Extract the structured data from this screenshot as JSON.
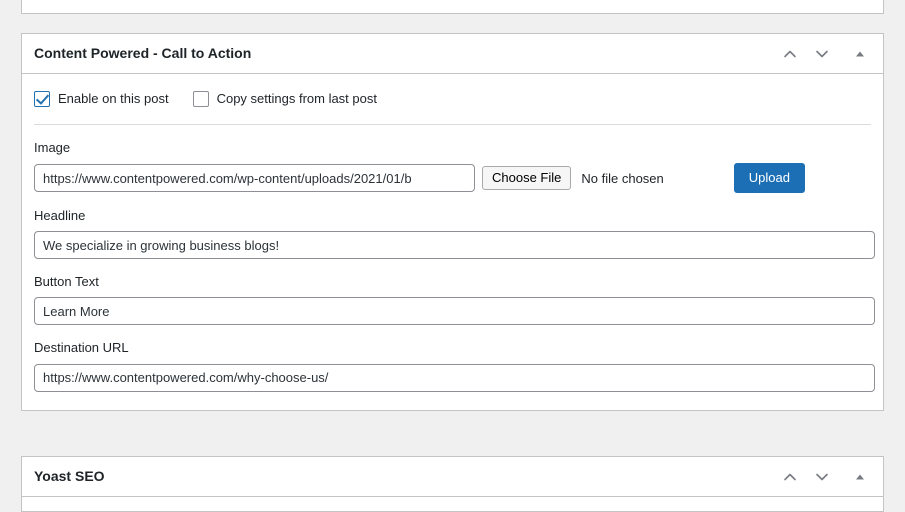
{
  "theme": {
    "background": "#f0f0f1",
    "panel_background": "#ffffff",
    "panel_border": "#c3c4c7",
    "accent_blue": "#2271b1",
    "upload_button_blue": "#1c6fb5",
    "text_color": "#1d2327"
  },
  "panels": [
    {
      "id": "cta",
      "title": "Content Powered - Call to Action",
      "actions": {
        "move_up": "order-higher-icon",
        "move_down": "order-lower-icon",
        "toggle": "toggle-indicator-icon"
      },
      "checkboxes": [
        {
          "label": "Enable on this post",
          "checked": true
        },
        {
          "label": "Copy settings from last post",
          "checked": false
        }
      ],
      "fields": [
        {
          "name": "image",
          "label": "Image",
          "value": "https://www.contentpowered.com/wp-content/uploads/2021/01/b",
          "placeholder": "",
          "file_button": "Choose File",
          "file_status": "No file chosen",
          "upload_button": "Upload"
        },
        {
          "name": "headline",
          "label": "Headline",
          "value": "We specialize in growing business blogs!",
          "placeholder": ""
        },
        {
          "name": "button_text",
          "label": "Button Text",
          "value": "Learn More",
          "placeholder": ""
        },
        {
          "name": "destination_url",
          "label": "Destination URL",
          "value": "https://www.contentpowered.com/why-choose-us/",
          "placeholder": ""
        }
      ]
    },
    {
      "id": "yoast",
      "title": "Yoast SEO",
      "actions": {
        "move_up": "order-higher-icon",
        "move_down": "order-lower-icon",
        "toggle": "toggle-indicator-icon"
      }
    }
  ]
}
